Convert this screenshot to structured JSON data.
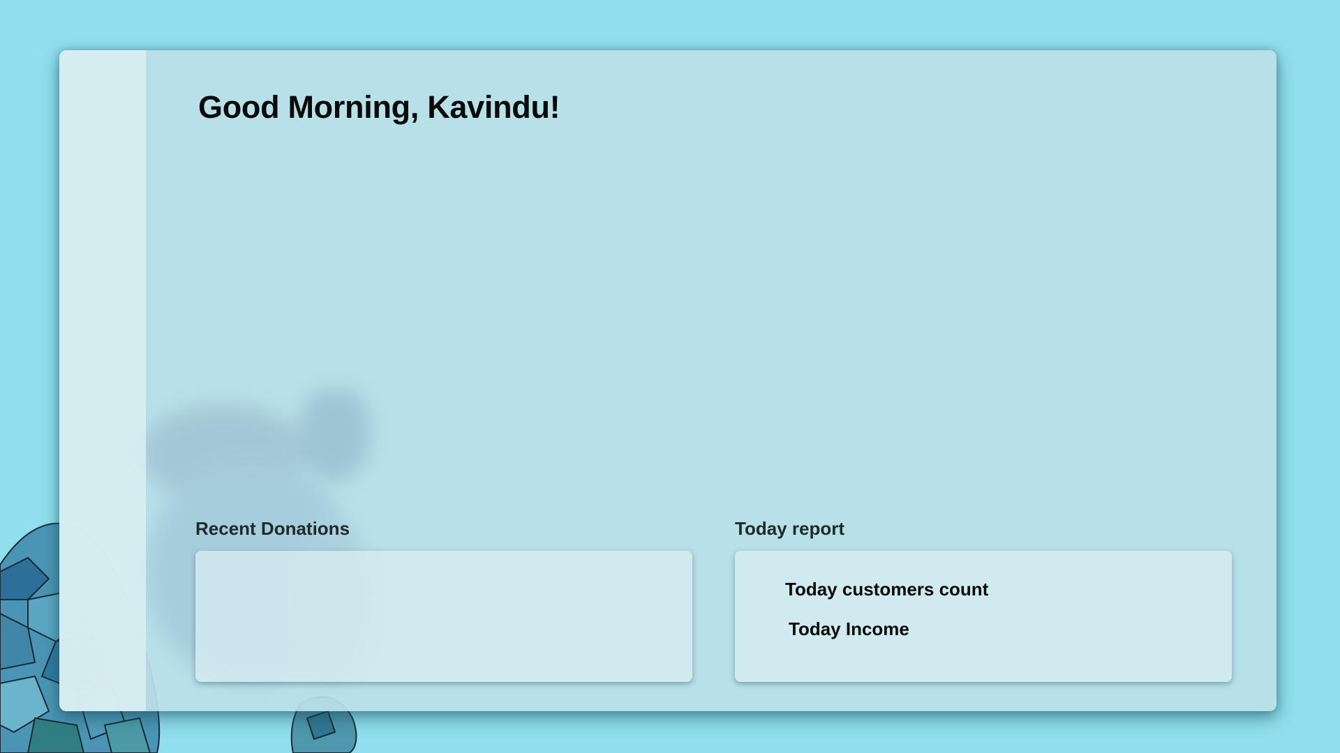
{
  "header": {
    "greeting": "Good Morning, Kavindu!"
  },
  "recent_donations": {
    "title": "Recent Donations"
  },
  "today_report": {
    "title": "Today report",
    "customers_count_label": "Today customers count",
    "income_label": "Today Income"
  },
  "colors": {
    "background": "#8fdfee",
    "panel": "#bae0e8",
    "card": "#d6ecf0",
    "text": "#0a0a0a"
  }
}
